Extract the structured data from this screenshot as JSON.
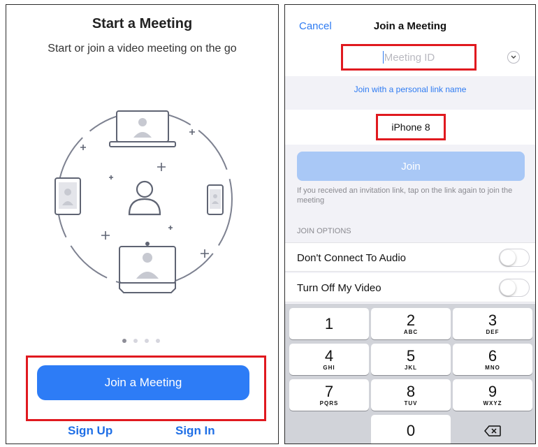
{
  "left": {
    "title": "Start a Meeting",
    "subtitle": "Start or join a video meeting on the go",
    "join_button": "Join a Meeting",
    "sign_up": "Sign Up",
    "sign_in": "Sign In",
    "carousel": {
      "pages": 4,
      "active_page": 1
    }
  },
  "right": {
    "cancel": "Cancel",
    "title": "Join a Meeting",
    "meeting_id_placeholder": "Meeting ID",
    "personal_link": "Join with a personal link name",
    "name_value": "iPhone 8",
    "join_button": "Join",
    "help_text": "If you received an invitation link, tap on the link again to join the meeting",
    "join_options_header": "JOIN OPTIONS",
    "options": [
      {
        "label": "Don't Connect To Audio",
        "on": false
      },
      {
        "label": "Turn Off My Video",
        "on": false
      }
    ],
    "keypad": [
      {
        "num": "1",
        "letters": ""
      },
      {
        "num": "2",
        "letters": "ABC"
      },
      {
        "num": "3",
        "letters": "DEF"
      },
      {
        "num": "4",
        "letters": "GHI"
      },
      {
        "num": "5",
        "letters": "JKL"
      },
      {
        "num": "6",
        "letters": "MNO"
      },
      {
        "num": "7",
        "letters": "PQRS"
      },
      {
        "num": "8",
        "letters": "TUV"
      },
      {
        "num": "9",
        "letters": "WXYZ"
      },
      {
        "num": "0",
        "letters": ""
      }
    ]
  },
  "colors": {
    "primary_blue": "#2d7cf6",
    "link_blue": "#2e7bf2",
    "disabled_blue": "#a9c8f6",
    "highlight_red": "#e0191f"
  }
}
